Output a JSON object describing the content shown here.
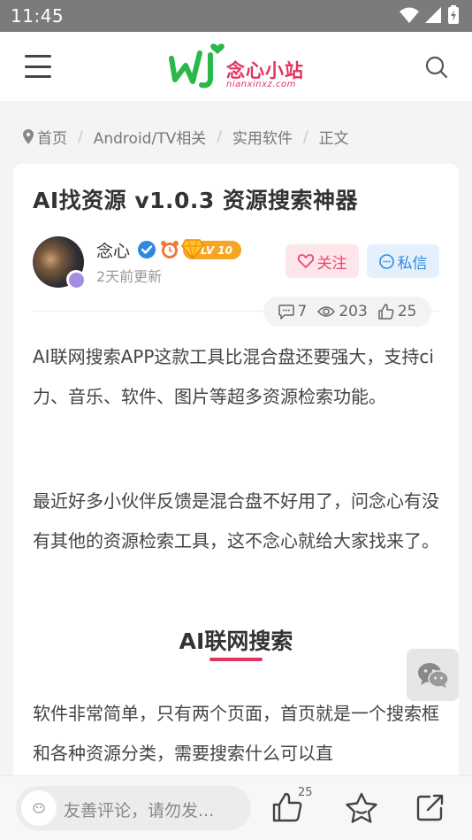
{
  "status_bar": {
    "time": "11:45"
  },
  "header": {
    "logo_name": "念心小站",
    "logo_domain": "nianxinxz.com"
  },
  "breadcrumb": [
    "首页",
    "Android/TV相关",
    "实用软件",
    "正文"
  ],
  "article": {
    "title": "AI找资源 v1.0.3 资源搜索神器",
    "author": "念心",
    "level": "LV 10",
    "updated": "2天前更新",
    "follow_label": "关注",
    "message_label": "私信",
    "stats": {
      "comments": "7",
      "views": "203",
      "likes": "25"
    },
    "paragraphs": [
      "AI联网搜索APP这款工具比混合盘还要强大，支持ci力、音乐、软件、图片等超多资源检索功能。",
      "最近好多小伙伴反馈是混合盘不好用了，问念心有没有其他的资源检索工具，这不念心就给大家找来了。",
      "软件非常简单，只有两个页面，首页就是一个搜索框和各种资源分类，需要搜索什么可以直"
    ],
    "section_heading": "AI联网搜索"
  },
  "bottom_bar": {
    "comment_placeholder": "友善评论，请勿发...",
    "like_count": "25"
  },
  "colors": {
    "accent": "#e0335f",
    "logo_green": "#2bb84a",
    "follow": "#f0436b",
    "message": "#2f88e0",
    "level": "#f5a623"
  }
}
